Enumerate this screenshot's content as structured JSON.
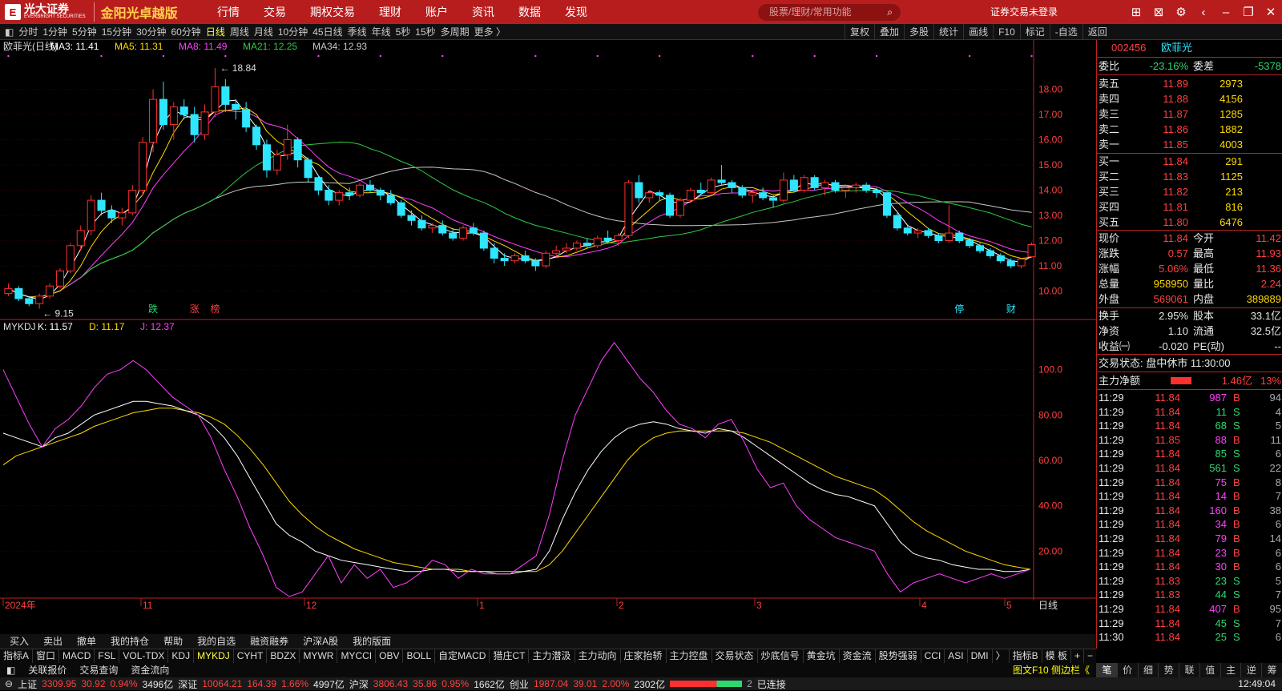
{
  "app": {
    "brand": "光大证券",
    "brand_en": "EVERBRIGHT SECURITIES",
    "edition": "金阳光卓越版",
    "logo_letter": "E"
  },
  "topnav": [
    "行情",
    "交易",
    "期权交易",
    "理财",
    "账户",
    "资讯",
    "数据",
    "发现"
  ],
  "search": {
    "placeholder": "股票/理财/常用功能"
  },
  "login_status": "证券交易未登录",
  "periods": [
    "分时",
    "1分钟",
    "5分钟",
    "15分钟",
    "30分钟",
    "60分钟",
    "日线",
    "周线",
    "月线",
    "10分钟",
    "45日线",
    "季线",
    "年线",
    "5秒",
    "15秒",
    "多周期",
    "更多 〉"
  ],
  "active_period": "日线",
  "right_tools": [
    "复权",
    "叠加",
    "多股",
    "统计",
    "画线",
    "F10",
    "标记",
    "-自选",
    "返回"
  ],
  "stock": {
    "code": "002456",
    "name": "欧菲光",
    "label": "欧菲光(日线)"
  },
  "ma": {
    "ma3": "MA3: 11.41",
    "ma5": "MA5: 11.31",
    "ma8": "MA8: 11.49",
    "ma21": "MA21: 12.25",
    "ma34": "MA34: 12.93"
  },
  "annotations": {
    "high": "18.84",
    "low": "9.15",
    "tags": [
      "跌",
      "涨",
      "榜",
      "停",
      "财"
    ]
  },
  "kdj": {
    "name": "MYKDJ",
    "k": "K: 11.57",
    "d": "D: 11.17",
    "j": "J: 12.37"
  },
  "x_axis": [
    "2024年",
    "11",
    "12",
    "1",
    "2",
    "3",
    "4",
    "5"
  ],
  "period_label": "日线",
  "price_axis": [
    "18.00",
    "17.00",
    "16.00",
    "15.00",
    "14.00",
    "13.00",
    "12.00",
    "11.00",
    "10.00"
  ],
  "kdj_axis": [
    "100.0",
    "80.00",
    "60.00",
    "40.00",
    "20.00"
  ],
  "quote": {
    "code": "002456",
    "name": "欧菲光",
    "weibi_label": "委比",
    "weibi": "-23.16%",
    "weicha_label": "委差",
    "weicha": "-5378",
    "asks": [
      {
        "label": "卖五",
        "price": "11.89",
        "vol": "2973"
      },
      {
        "label": "卖四",
        "price": "11.88",
        "vol": "4156"
      },
      {
        "label": "卖三",
        "price": "11.87",
        "vol": "1285"
      },
      {
        "label": "卖二",
        "price": "11.86",
        "vol": "1882"
      },
      {
        "label": "卖一",
        "price": "11.85",
        "vol": "4003"
      }
    ],
    "bids": [
      {
        "label": "买一",
        "price": "11.84",
        "vol": "291"
      },
      {
        "label": "买二",
        "price": "11.83",
        "vol": "1125"
      },
      {
        "label": "买三",
        "price": "11.82",
        "vol": "213"
      },
      {
        "label": "买四",
        "price": "11.81",
        "vol": "816"
      },
      {
        "label": "买五",
        "price": "11.80",
        "vol": "6476"
      }
    ],
    "stats": [
      {
        "l1": "现价",
        "v1": "11.84",
        "l2": "今开",
        "v2": "11.42",
        "c1": "up",
        "c2": "up"
      },
      {
        "l1": "涨跌",
        "v1": "0.57",
        "l2": "最高",
        "v2": "11.93",
        "c1": "up",
        "c2": "up"
      },
      {
        "l1": "涨幅",
        "v1": "5.06%",
        "l2": "最低",
        "v2": "11.36",
        "c1": "up",
        "c2": "up"
      },
      {
        "l1": "总量",
        "v1": "958950",
        "l2": "量比",
        "v2": "2.24",
        "c1": "yl",
        "c2": "up"
      },
      {
        "l1": "外盘",
        "v1": "569061",
        "l2": "内盘",
        "v2": "389889",
        "c1": "up",
        "c2": "yl"
      }
    ],
    "stats2": [
      {
        "l1": "换手",
        "v1": "2.95%",
        "l2": "股本",
        "v2": "33.1亿"
      },
      {
        "l1": "净资",
        "v1": "1.10",
        "l2": "流通",
        "v2": "32.5亿"
      },
      {
        "l1": "收益㈠",
        "v1": "-0.020",
        "l2": "PE(动)",
        "v2": "--"
      }
    ],
    "trade_status": "交易状态: 盘中休市 11:30:00",
    "main_flow_label": "主力净额",
    "main_flow": "1.46亿",
    "main_flow_pct": "13%",
    "ticks": [
      {
        "t": "11:29",
        "p": "11.84",
        "v": "987",
        "d": "B",
        "n": "94"
      },
      {
        "t": "11:29",
        "p": "11.84",
        "v": "11",
        "d": "S",
        "n": "4"
      },
      {
        "t": "11:29",
        "p": "11.84",
        "v": "68",
        "d": "S",
        "n": "5"
      },
      {
        "t": "11:29",
        "p": "11.85",
        "v": "88",
        "d": "B",
        "n": "11"
      },
      {
        "t": "11:29",
        "p": "11.84",
        "v": "85",
        "d": "S",
        "n": "6"
      },
      {
        "t": "11:29",
        "p": "11.84",
        "v": "561",
        "d": "S",
        "n": "22"
      },
      {
        "t": "11:29",
        "p": "11.84",
        "v": "75",
        "d": "B",
        "n": "8"
      },
      {
        "t": "11:29",
        "p": "11.84",
        "v": "14",
        "d": "B",
        "n": "7"
      },
      {
        "t": "11:29",
        "p": "11.84",
        "v": "160",
        "d": "B",
        "n": "38"
      },
      {
        "t": "11:29",
        "p": "11.84",
        "v": "34",
        "d": "B",
        "n": "6"
      },
      {
        "t": "11:29",
        "p": "11.84",
        "v": "79",
        "d": "B",
        "n": "14"
      },
      {
        "t": "11:29",
        "p": "11.84",
        "v": "23",
        "d": "B",
        "n": "6"
      },
      {
        "t": "11:29",
        "p": "11.84",
        "v": "30",
        "d": "B",
        "n": "6"
      },
      {
        "t": "11:29",
        "p": "11.83",
        "v": "23",
        "d": "S",
        "n": "5"
      },
      {
        "t": "11:29",
        "p": "11.83",
        "v": "44",
        "d": "S",
        "n": "7"
      },
      {
        "t": "11:29",
        "p": "11.84",
        "v": "407",
        "d": "B",
        "n": "95"
      },
      {
        "t": "11:29",
        "p": "11.84",
        "v": "45",
        "d": "S",
        "n": "7"
      },
      {
        "t": "11:30",
        "p": "11.84",
        "v": "25",
        "d": "S",
        "n": "6"
      }
    ]
  },
  "indicator_tabs": [
    "指标A",
    "窗口",
    "MACD",
    "FSL",
    "VOL-TDX",
    "KDJ",
    "MYKDJ",
    "CYHT",
    "BDZX",
    "MYWR",
    "MYCCI",
    "OBV",
    "BOLL",
    "自定MACD",
    "猎庄CT",
    "主力潜汲",
    "主力动向",
    "庄家抬轿",
    "主力控盘",
    "交易状态",
    "炒底信号",
    "黄金坑",
    "资金流",
    "股势强弱",
    "CCI",
    "ASI",
    "DMI",
    "〉",
    "指标B",
    "模 板",
    "+",
    "−"
  ],
  "active_indicator": "MYKDJ",
  "link_tabs": [
    "关联报价",
    "交易查询",
    "资金流向"
  ],
  "f10_link": "图文F10 侧边栏《",
  "side_tabs": [
    "笔",
    "价",
    "细",
    "势",
    "联",
    "值",
    "主",
    "逆",
    "筹"
  ],
  "active_side_tab": "笔",
  "actions": [
    "买入",
    "卖出",
    "撤单",
    "我的持仓",
    "帮助",
    "我的自选",
    "融资融券",
    "沪深A股",
    "我的版面"
  ],
  "indices": [
    {
      "name": "上证",
      "val": "3309.95",
      "chg": "30.92",
      "pct": "0.94%",
      "amt": "3496亿"
    },
    {
      "name": "深证",
      "val": "10064.21",
      "chg": "164.39",
      "pct": "1.66%",
      "amt": "4997亿"
    },
    {
      "name": "沪深",
      "val": "3806.43",
      "chg": "35.86",
      "pct": "0.95%",
      "amt": "1662亿"
    },
    {
      "name": "创业",
      "val": "1987.04",
      "chg": "39.01",
      "pct": "2.00%",
      "amt": "2302亿"
    }
  ],
  "connection": "已连接",
  "connection_count": "2",
  "clock": "12:49:04",
  "chart_data": {
    "type": "candlestick",
    "title": "欧菲光(日线)",
    "price_range": [
      9.0,
      19.0
    ],
    "kdj_range": [
      0,
      120
    ],
    "candles": [
      [
        9.9,
        10.3,
        9.8,
        10.1
      ],
      [
        10.1,
        10.2,
        9.6,
        9.7
      ],
      [
        9.7,
        9.8,
        9.4,
        9.5
      ],
      [
        9.5,
        9.9,
        9.3,
        9.8
      ],
      [
        9.8,
        10.3,
        9.7,
        10.2
      ],
      [
        10.2,
        10.9,
        10.1,
        10.8
      ],
      [
        10.8,
        11.9,
        10.7,
        11.8
      ],
      [
        11.8,
        12.6,
        11.6,
        12.4
      ],
      [
        12.4,
        13.8,
        12.2,
        13.6
      ],
      [
        13.6,
        13.9,
        13.0,
        13.2
      ],
      [
        13.2,
        13.4,
        12.7,
        12.9
      ],
      [
        12.9,
        13.3,
        12.6,
        13.1
      ],
      [
        13.1,
        14.2,
        13.0,
        14.0
      ],
      [
        14.0,
        16.1,
        13.8,
        15.9
      ],
      [
        15.9,
        18.0,
        15.5,
        17.6
      ],
      [
        17.6,
        18.3,
        16.4,
        16.6
      ],
      [
        16.6,
        17.5,
        16.0,
        17.3
      ],
      [
        17.3,
        17.6,
        16.8,
        17.0
      ],
      [
        17.0,
        17.3,
        15.9,
        16.2
      ],
      [
        16.2,
        17.4,
        16.0,
        17.1
      ],
      [
        17.1,
        18.84,
        16.9,
        18.1
      ],
      [
        18.1,
        18.4,
        17.1,
        17.4
      ],
      [
        17.4,
        17.6,
        16.8,
        17.2
      ],
      [
        17.2,
        17.5,
        16.3,
        16.5
      ],
      [
        16.5,
        16.6,
        15.6,
        15.8
      ],
      [
        15.8,
        16.0,
        14.5,
        14.8
      ],
      [
        14.8,
        15.6,
        14.6,
        15.4
      ],
      [
        15.4,
        16.6,
        15.2,
        16.0
      ],
      [
        16.0,
        16.1,
        14.9,
        15.2
      ],
      [
        15.2,
        15.3,
        14.3,
        14.5
      ],
      [
        14.5,
        14.6,
        13.8,
        14.0
      ],
      [
        14.0,
        14.2,
        13.4,
        13.6
      ],
      [
        13.6,
        14.0,
        13.4,
        13.9
      ],
      [
        13.9,
        14.1,
        13.6,
        13.8
      ],
      [
        13.8,
        14.3,
        13.7,
        14.2
      ],
      [
        14.2,
        14.4,
        13.9,
        14.0
      ],
      [
        14.0,
        14.1,
        13.6,
        13.8
      ],
      [
        13.8,
        14.0,
        13.4,
        13.5
      ],
      [
        13.5,
        13.6,
        12.9,
        13.0
      ],
      [
        13.0,
        13.2,
        12.6,
        12.8
      ],
      [
        12.8,
        13.0,
        12.4,
        12.5
      ],
      [
        12.5,
        12.7,
        12.3,
        12.6
      ],
      [
        12.6,
        12.8,
        12.2,
        12.3
      ],
      [
        12.3,
        12.5,
        12.0,
        12.1
      ],
      [
        12.1,
        12.6,
        12.0,
        12.5
      ],
      [
        12.5,
        12.7,
        12.2,
        12.3
      ],
      [
        12.3,
        12.4,
        11.6,
        11.7
      ],
      [
        11.7,
        11.9,
        11.1,
        11.3
      ],
      [
        11.3,
        11.5,
        11.0,
        11.2
      ],
      [
        11.2,
        11.5,
        11.1,
        11.4
      ],
      [
        11.4,
        11.6,
        11.1,
        11.2
      ],
      [
        11.2,
        11.3,
        10.8,
        11.0
      ],
      [
        11.0,
        11.6,
        10.9,
        11.5
      ],
      [
        11.5,
        11.8,
        11.3,
        11.6
      ],
      [
        11.6,
        11.9,
        11.5,
        11.7
      ],
      [
        11.7,
        12.0,
        11.6,
        11.9
      ],
      [
        11.9,
        12.1,
        11.7,
        11.8
      ],
      [
        11.8,
        12.2,
        11.7,
        12.1
      ],
      [
        12.1,
        12.4,
        11.9,
        12.0
      ],
      [
        12.0,
        12.3,
        11.8,
        12.2
      ],
      [
        12.2,
        14.4,
        12.1,
        14.3
      ],
      [
        14.3,
        14.6,
        13.5,
        13.7
      ],
      [
        13.7,
        14.0,
        13.5,
        13.9
      ],
      [
        13.9,
        14.0,
        13.6,
        13.8
      ],
      [
        13.8,
        13.9,
        12.9,
        13.0
      ],
      [
        13.0,
        13.7,
        12.9,
        13.6
      ],
      [
        13.6,
        14.1,
        13.5,
        14.0
      ],
      [
        14.0,
        14.3,
        13.8,
        13.9
      ],
      [
        13.9,
        14.5,
        13.8,
        14.4
      ],
      [
        14.4,
        15.0,
        14.2,
        14.3
      ],
      [
        14.3,
        14.4,
        13.9,
        14.1
      ],
      [
        14.1,
        14.2,
        13.7,
        13.8
      ],
      [
        13.8,
        14.0,
        13.5,
        13.9
      ],
      [
        13.9,
        14.1,
        13.6,
        13.7
      ],
      [
        13.7,
        13.8,
        13.3,
        13.6
      ],
      [
        13.6,
        14.7,
        13.5,
        14.4
      ],
      [
        14.4,
        14.6,
        13.9,
        14.0
      ],
      [
        14.0,
        14.6,
        13.9,
        14.5
      ],
      [
        14.5,
        14.6,
        14.0,
        14.1
      ],
      [
        14.1,
        14.4,
        13.8,
        14.3
      ],
      [
        14.3,
        14.4,
        13.9,
        14.0
      ],
      [
        14.0,
        14.2,
        13.7,
        14.1
      ],
      [
        14.1,
        14.3,
        13.9,
        14.2
      ],
      [
        14.2,
        14.3,
        13.9,
        14.0
      ],
      [
        14.0,
        14.1,
        13.7,
        13.9
      ],
      [
        13.9,
        13.9,
        12.9,
        13.0
      ],
      [
        13.0,
        13.1,
        12.4,
        12.5
      ],
      [
        12.5,
        12.6,
        12.2,
        12.3
      ],
      [
        12.3,
        12.5,
        12.1,
        12.4
      ],
      [
        12.4,
        12.5,
        12.1,
        12.2
      ],
      [
        12.2,
        12.3,
        11.9,
        12.0
      ],
      [
        12.0,
        13.4,
        11.9,
        12.3
      ],
      [
        12.3,
        12.4,
        11.9,
        12.0
      ],
      [
        12.0,
        12.1,
        11.7,
        11.8
      ],
      [
        11.8,
        11.9,
        11.5,
        11.6
      ],
      [
        11.6,
        11.7,
        11.3,
        11.4
      ],
      [
        11.4,
        11.5,
        11.1,
        11.2
      ],
      [
        11.2,
        11.3,
        10.9,
        11.0
      ],
      [
        11.0,
        11.3,
        10.9,
        11.27
      ],
      [
        11.36,
        11.93,
        11.36,
        11.84
      ]
    ],
    "kdj_series": {
      "k": [
        72,
        70,
        68,
        66,
        70,
        72,
        76,
        80,
        82,
        84,
        86,
        86,
        85,
        84,
        82,
        80,
        76,
        70,
        62,
        52,
        42,
        32,
        27,
        24,
        20,
        18,
        16,
        15,
        14,
        13,
        12,
        11,
        11,
        12,
        12,
        11,
        11,
        11,
        10,
        10,
        11,
        12,
        20,
        34,
        46,
        56,
        64,
        70,
        74,
        76,
        77,
        76,
        74,
        73,
        72,
        74,
        73,
        70,
        66,
        62,
        58,
        54,
        50,
        47,
        45,
        44,
        42,
        40,
        32,
        24,
        19,
        17,
        16,
        14,
        13,
        12,
        12,
        11,
        11,
        12
      ],
      "d": [
        58,
        62,
        64,
        66,
        68,
        70,
        72,
        75,
        77,
        79,
        81,
        82,
        83,
        83,
        82,
        81,
        79,
        76,
        71,
        65,
        58,
        50,
        42,
        36,
        31,
        27,
        24,
        21,
        19,
        17,
        15,
        14,
        13,
        12,
        12,
        12,
        11,
        11,
        11,
        11,
        11,
        11,
        14,
        20,
        28,
        36,
        44,
        52,
        60,
        66,
        70,
        72,
        73,
        73,
        73,
        73,
        73,
        72,
        70,
        68,
        65,
        62,
        59,
        56,
        53,
        51,
        49,
        47,
        43,
        38,
        33,
        29,
        26,
        23,
        20,
        18,
        16,
        14,
        13,
        12
      ],
      "j": [
        100,
        88,
        76,
        66,
        74,
        78,
        84,
        92,
        98,
        100,
        104,
        100,
        94,
        88,
        84,
        80,
        70,
        56,
        44,
        30,
        18,
        4,
        0,
        2,
        10,
        18,
        6,
        14,
        8,
        12,
        4,
        6,
        10,
        16,
        14,
        8,
        12,
        10,
        10,
        10,
        14,
        18,
        36,
        60,
        80,
        92,
        104,
        112,
        104,
        96,
        90,
        82,
        76,
        74,
        70,
        76,
        78,
        68,
        56,
        48,
        50,
        40,
        34,
        30,
        26,
        24,
        22,
        20,
        10,
        2,
        6,
        8,
        10,
        8,
        6,
        8,
        10,
        8,
        10,
        12
      ]
    },
    "last_values": {
      "k": 11.57,
      "d": 11.17,
      "j": 12.37,
      "ma3": 11.41,
      "ma5": 11.31,
      "ma8": 11.49,
      "ma21": 12.25,
      "ma34": 12.93
    }
  }
}
